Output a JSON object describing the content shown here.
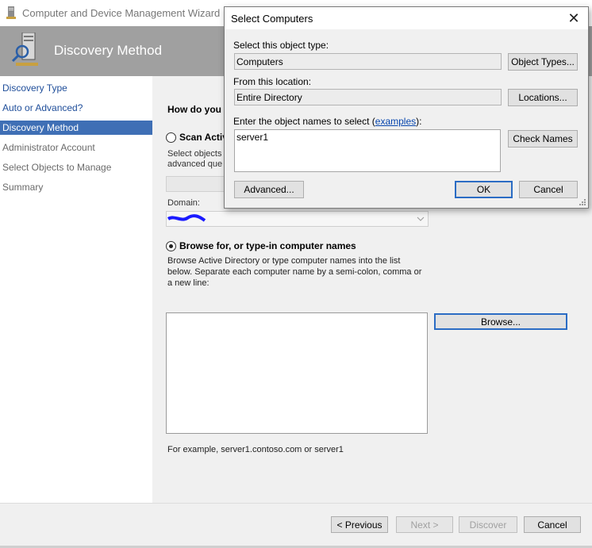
{
  "wizard": {
    "title": "Computer and Device Management Wizard",
    "banner_title": "Discovery Method",
    "nav": [
      {
        "label": "Discovery Type",
        "state": "link"
      },
      {
        "label": "Auto or Advanced?",
        "state": "link"
      },
      {
        "label": "Discovery Method",
        "state": "selected"
      },
      {
        "label": "Administrator Account",
        "state": "dim"
      },
      {
        "label": "Select Objects to Manage",
        "state": "dim"
      },
      {
        "label": "Summary",
        "state": "dim"
      }
    ],
    "heading_partial": "How do you w",
    "scan_option_label": "Scan Activ",
    "scan_desc_line1": "Select objects",
    "scan_desc_line2": "advanced que",
    "domain_label": "Domain:",
    "browse_option_label": "Browse for, or type-in computer names",
    "browse_desc": "Browse Active Directory or type computer names into the list below. Separate each computer name by a semi-colon, comma or a new line:",
    "browse_button": "Browse...",
    "example_text": "For example, server1.contoso.com or server1",
    "buttons": {
      "previous": "< Previous",
      "next": "Next >",
      "discover": "Discover",
      "cancel": "Cancel"
    }
  },
  "dialog": {
    "title": "Select Computers",
    "object_type_label": "Select this object type:",
    "object_type_value": "Computers",
    "object_types_button": "Object Types...",
    "location_label": "From this location:",
    "location_value": "Entire Directory",
    "locations_button": "Locations...",
    "enter_names_prefix": "Enter the object names to select (",
    "examples_link": "examples",
    "enter_names_suffix": "):",
    "names_value": "server1",
    "check_names_button": "Check Names",
    "advanced_button": "Advanced...",
    "ok_button": "OK",
    "cancel_button": "Cancel"
  },
  "colors": {
    "selection": "#3f6fb5",
    "banner": "#a0a0a0",
    "link": "#0645ad",
    "redaction": "#1a1aff"
  }
}
